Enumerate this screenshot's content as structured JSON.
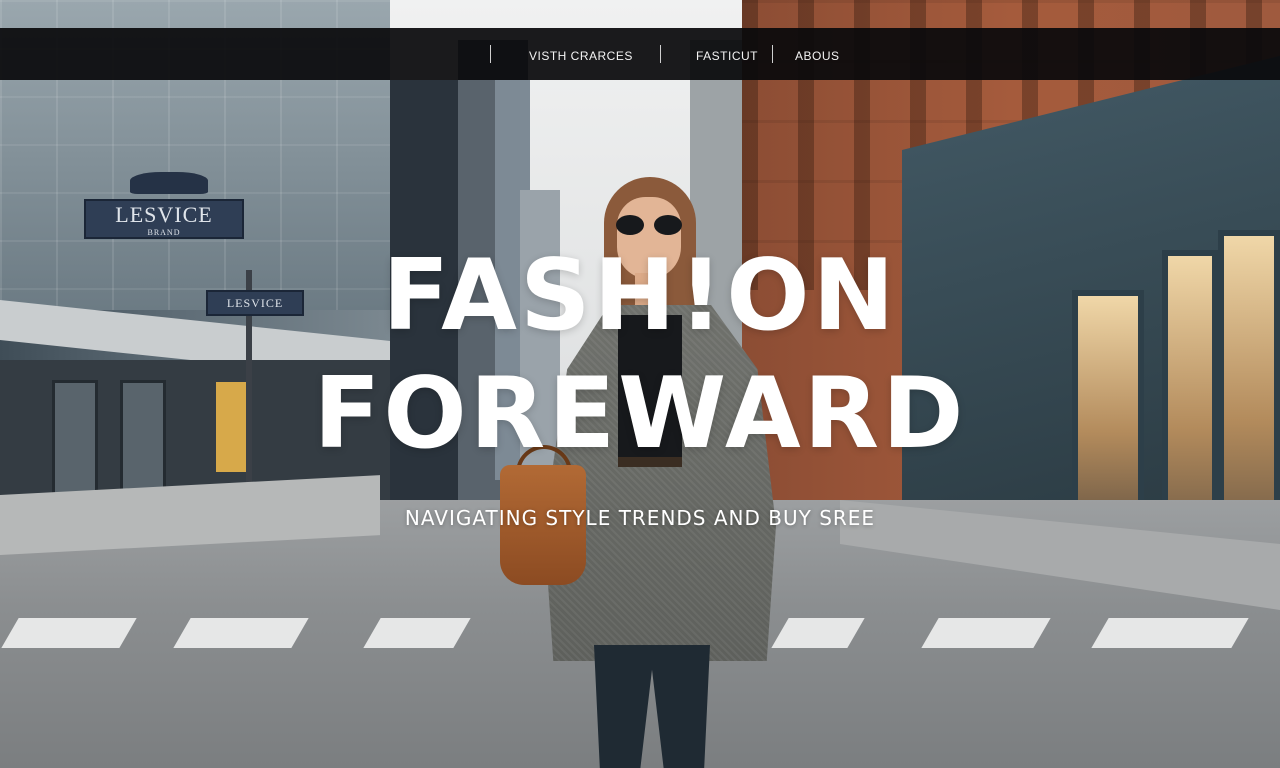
{
  "nav": {
    "links": [
      {
        "label": "VISTH CRARCES"
      },
      {
        "label": "FASTICUT"
      },
      {
        "label": "ABOUS"
      }
    ]
  },
  "hero": {
    "headline_line1": "FASH!ON",
    "headline_line2": "FOREWARD",
    "tagline": "NAVIGATING STYLE TRENDS AND BUY SREE"
  },
  "background": {
    "sign_main": "LESVICE",
    "sign_main_sub": "BRAND",
    "sign_small": "LESVICE",
    "description_icon": "street-scene-photo"
  },
  "colors": {
    "navbar_bg": "#0a0a0c",
    "text": "#ffffff"
  }
}
